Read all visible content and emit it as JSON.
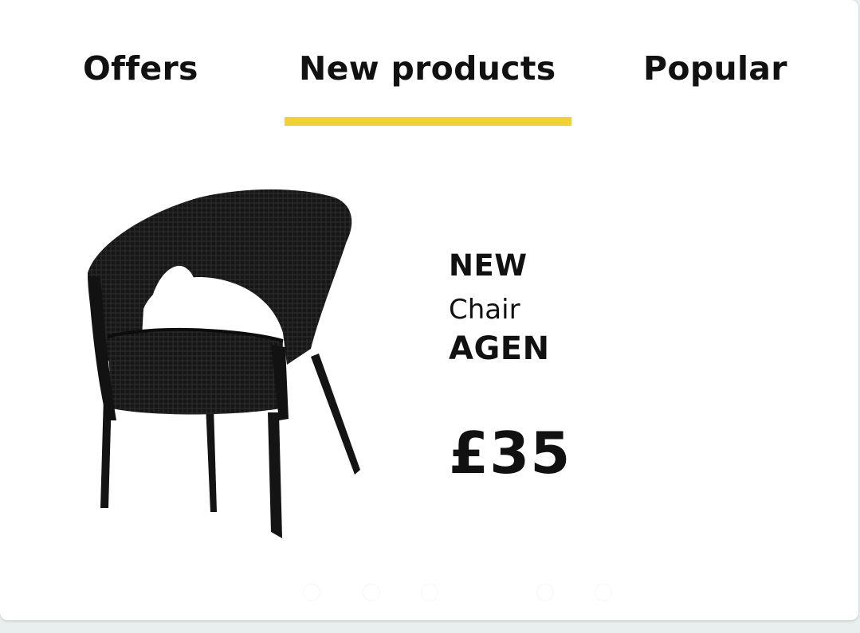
{
  "tabs": {
    "offers_label": "Offers",
    "new_products_label": "New products",
    "popular_label": "Popular",
    "active": "New products",
    "underline_color": "#f2d132"
  },
  "product": {
    "badge": "NEW",
    "type": "Chair",
    "name": "AGEN",
    "price": "£35",
    "image_icon": "wicker-chair-image"
  },
  "carousel": {
    "dot_count": 5
  }
}
